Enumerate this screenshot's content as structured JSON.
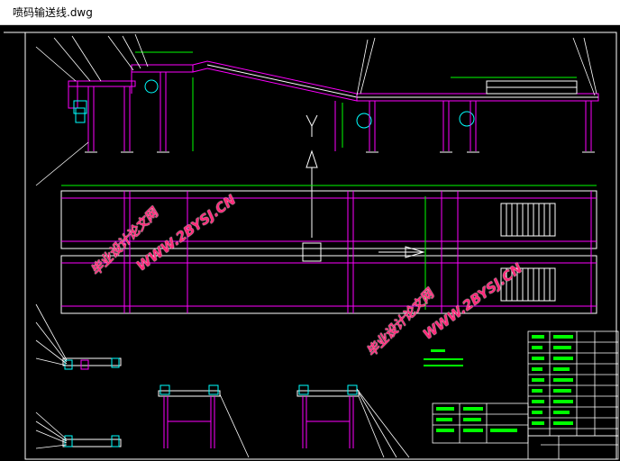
{
  "window": {
    "title": "喷码输送线.dwg"
  },
  "watermark": {
    "school_text": "毕业设计论文网",
    "url_text": "WWW.2BYSJ.CN"
  },
  "colors": {
    "background": "#000000",
    "frame_white": "#ffffff",
    "conveyor_magenta": "#ff00ff",
    "leader_white": "#ffffff",
    "dimension_green": "#00ff00",
    "support_cyan": "#00ffff",
    "watermark_pink": "#ff2a7a"
  }
}
